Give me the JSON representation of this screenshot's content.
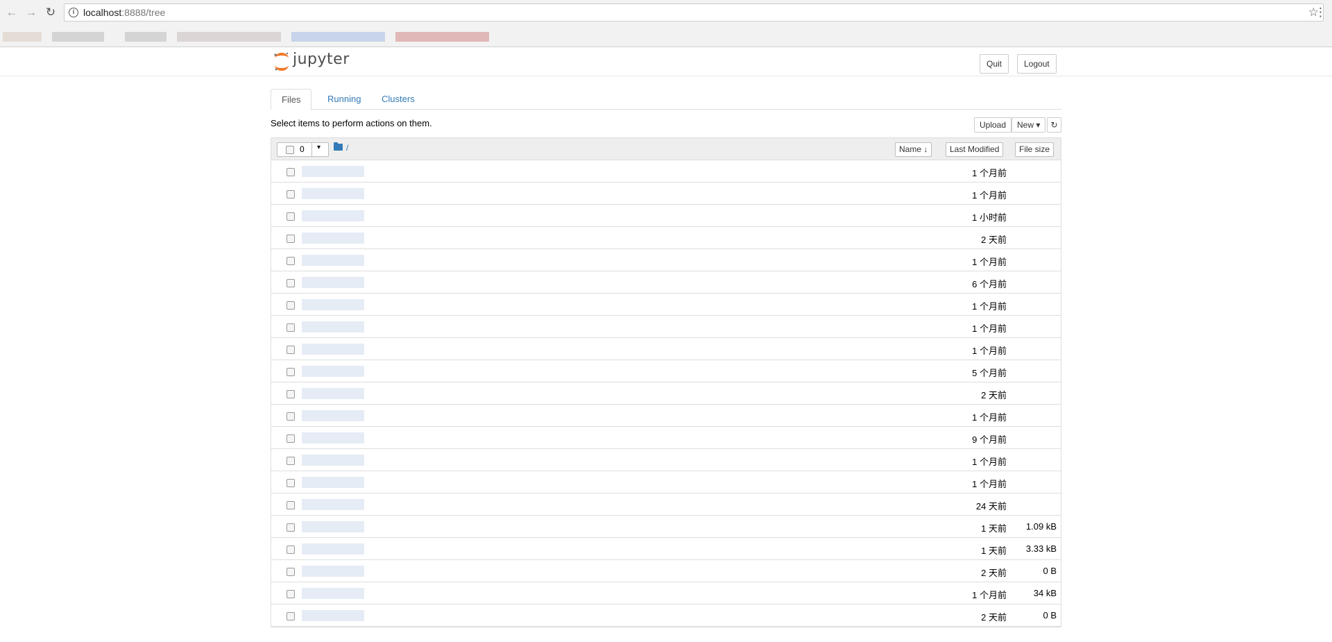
{
  "browser": {
    "url_host": "localhost",
    "url_path": ":8888/tree",
    "back_icon": "arrow-left",
    "forward_icon": "arrow-right",
    "reload_icon": "reload",
    "star_icon": "star",
    "menu_icon": "vertical-dots"
  },
  "header": {
    "logo_text": "jupyter",
    "quit_label": "Quit",
    "logout_label": "Logout"
  },
  "tabs": [
    {
      "label": "Files"
    },
    {
      "label": "Running"
    },
    {
      "label": "Clusters"
    }
  ],
  "toolbar": {
    "message": "Select items to perform actions on them.",
    "upload_label": "Upload",
    "new_label": "New ▾",
    "refresh_icon": "refresh"
  },
  "list_header": {
    "selected_count": "0",
    "breadcrumb": "/",
    "name_label": "Name ↓",
    "modified_label": "Last Modified",
    "size_label": "File size"
  },
  "rows": [
    {
      "modified": "1 个月前",
      "size": ""
    },
    {
      "modified": "1 个月前",
      "size": ""
    },
    {
      "modified": "1 小时前",
      "size": ""
    },
    {
      "modified": "2 天前",
      "size": ""
    },
    {
      "modified": "1 个月前",
      "size": ""
    },
    {
      "modified": "6 个月前",
      "size": ""
    },
    {
      "modified": "1 个月前",
      "size": ""
    },
    {
      "modified": "1 个月前",
      "size": ""
    },
    {
      "modified": "1 个月前",
      "size": ""
    },
    {
      "modified": "5 个月前",
      "size": ""
    },
    {
      "modified": "2 天前",
      "size": ""
    },
    {
      "modified": "1 个月前",
      "size": ""
    },
    {
      "modified": "9 个月前",
      "size": ""
    },
    {
      "modified": "1 个月前",
      "size": ""
    },
    {
      "modified": "1 个月前",
      "size": ""
    },
    {
      "modified": "24 天前",
      "size": ""
    },
    {
      "modified": "1 天前",
      "size": "1.09 kB"
    },
    {
      "modified": "1 天前",
      "size": "3.33 kB"
    },
    {
      "modified": "2 天前",
      "size": "0 B"
    },
    {
      "modified": "1 个月前",
      "size": "34 kB"
    },
    {
      "modified": "2 天前",
      "size": "0 B"
    }
  ]
}
